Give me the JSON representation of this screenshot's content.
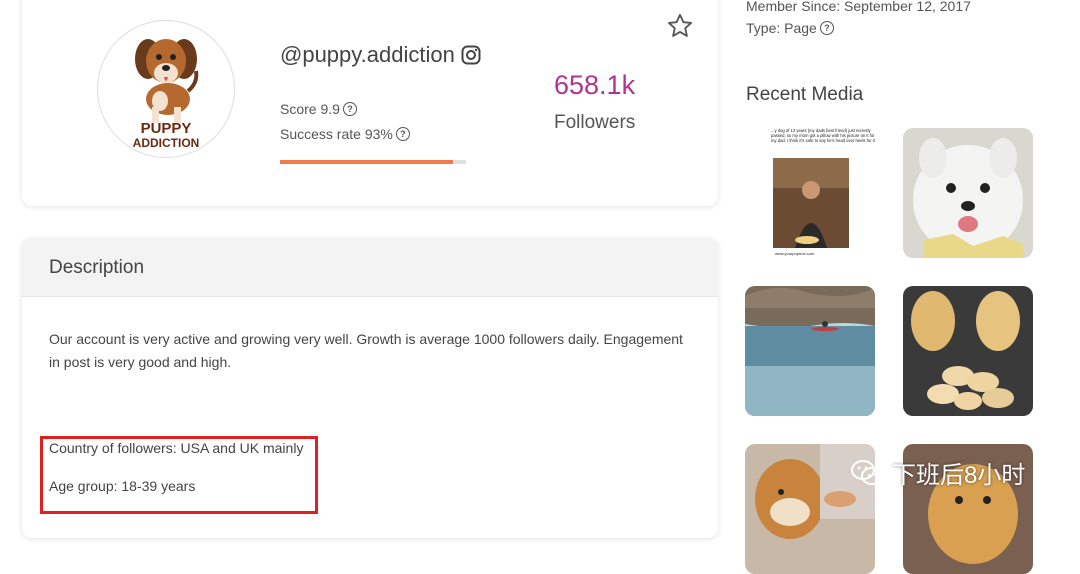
{
  "profile": {
    "handle": "@puppy.addiction",
    "avatar_text_top": "PUPPY",
    "avatar_text_bottom": "ADDICTION",
    "score": "Score 9.9",
    "success_rate": "Success rate 93%",
    "success_progress": 0.93,
    "followers_count": "658.1k",
    "followers_label": "Followers",
    "accent_color": "#b0338e",
    "progress_color": "#f07a4a"
  },
  "description": {
    "title": "Description",
    "body": "Our account is very active and growing very well. Growth is average 1000 followers daily. Engagement in post is very good and high.",
    "country": "Country of followers: USA and UK mainly",
    "age_group": "Age group: 18-39 years"
  },
  "meta": {
    "member_since": "Member Since: September 12, 2017",
    "type": "Type: Page"
  },
  "recent_media": {
    "title": "Recent Media",
    "first_caption": "...y dog of 12 years (my dads best friend) just recently passed, so my mom got a pillow with his picture on it for my dad. I think it's safe to say he's head over heels for it",
    "first_caption_url": "www.yourpuphub.com"
  },
  "watermark": {
    "text": "下班后8小时"
  },
  "icons": {
    "instagram": "instagram-icon",
    "star": "star-icon",
    "help": "help-icon"
  }
}
